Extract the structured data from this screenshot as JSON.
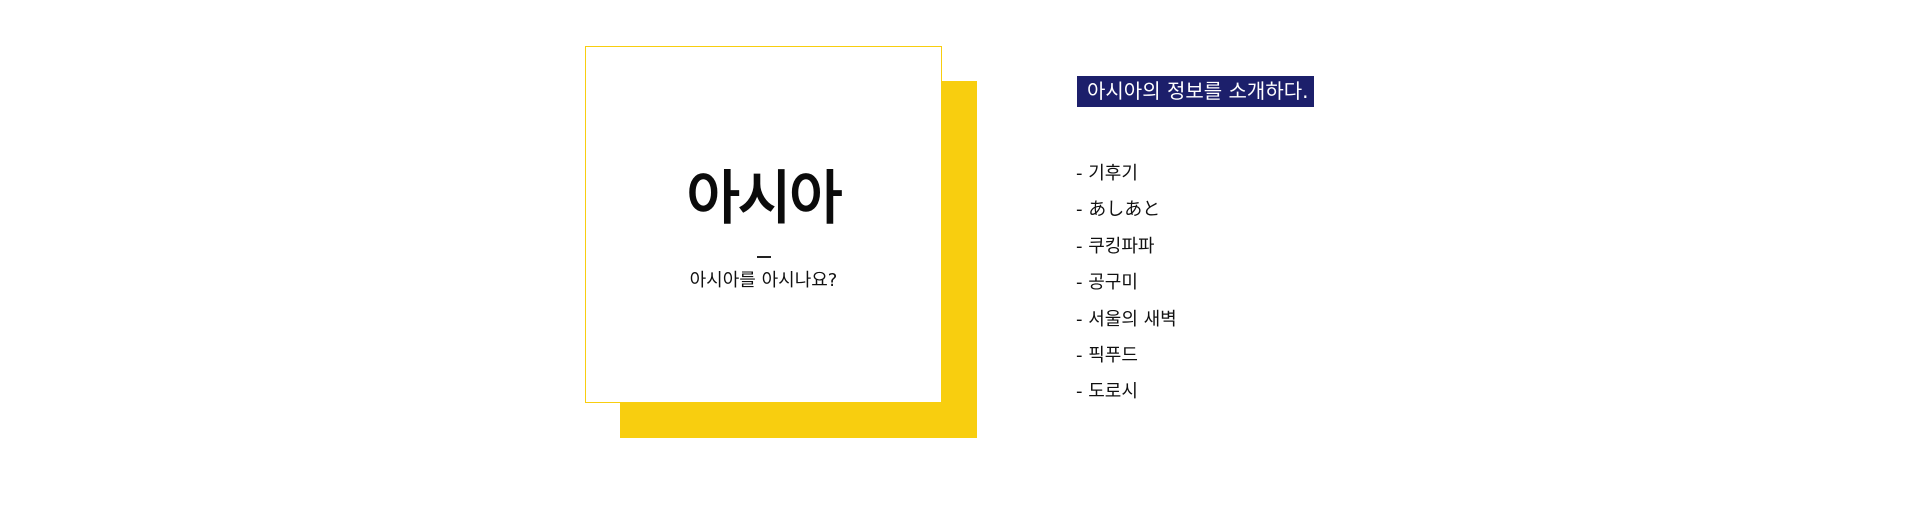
{
  "card": {
    "title": "아시아",
    "subtitle": "아시아를 아시나요?",
    "colors": {
      "accent": "#f8ce0f",
      "border": "#f8ce0f"
    }
  },
  "info": {
    "badge": "아시아의 정보를 소개하다.",
    "badge_color": "#1c1f6b",
    "items": [
      "- 기후기",
      "- あしあと",
      "- 쿠킹파파",
      "- 공구미",
      "- 서울의 새벽",
      "- 픽푸드",
      "- 도로시"
    ]
  }
}
